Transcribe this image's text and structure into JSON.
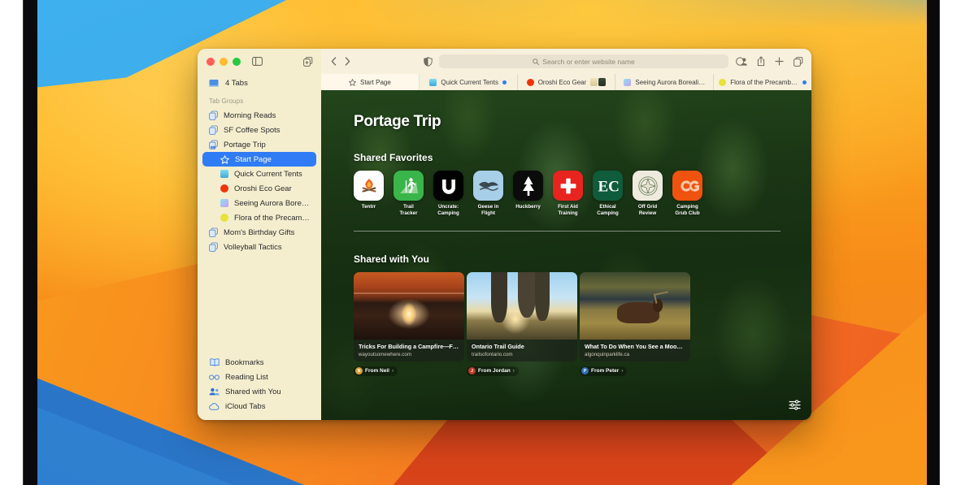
{
  "window": {
    "app": "Safari",
    "traffic_lights": [
      "close",
      "minimize",
      "zoom"
    ],
    "sidebar_toggle": "sidebar-toggle-icon",
    "new_tab_group": "new-tab-group-icon"
  },
  "sidebar": {
    "tabs_count_label": "4 Tabs",
    "section_title": "Tab Groups",
    "groups": [
      {
        "label": "Morning Reads",
        "icon": "tab-group-icon",
        "selected": false,
        "child": false
      },
      {
        "label": "SF Coffee Spots",
        "icon": "tab-group-icon",
        "selected": false,
        "child": false
      },
      {
        "label": "Portage Trip",
        "icon": "tab-group-shared-icon",
        "selected": false,
        "child": false
      },
      {
        "label": "Start Page",
        "icon": "star-icon",
        "selected": true,
        "child": true
      },
      {
        "label": "Quick Current Tents",
        "icon": "favicon",
        "color": "#5ac8e8",
        "selected": false,
        "child": true
      },
      {
        "label": "Oroshi Eco Gear",
        "icon": "favicon",
        "color": "#f0340a",
        "selected": false,
        "child": true,
        "round": true
      },
      {
        "label": "Seeing Aurora Bore…",
        "icon": "favicon",
        "color": "#b08ef0",
        "selected": false,
        "child": true
      },
      {
        "label": "Flora of the Precam…",
        "icon": "favicon",
        "color": "#e8e23a",
        "selected": false,
        "child": true,
        "round": true
      },
      {
        "label": "Mom's Birthday Gifts",
        "icon": "tab-group-icon",
        "selected": false,
        "child": false
      },
      {
        "label": "Volleyball Tactics",
        "icon": "tab-group-icon",
        "selected": false,
        "child": false
      }
    ],
    "bottom_items": [
      {
        "label": "Bookmarks",
        "icon": "book-icon"
      },
      {
        "label": "Reading List",
        "icon": "glasses-icon"
      },
      {
        "label": "Shared with You",
        "icon": "people-icon"
      },
      {
        "label": "iCloud Tabs",
        "icon": "cloud-icon"
      }
    ]
  },
  "toolbar": {
    "back": "chevron-left-icon",
    "forward": "chevron-right-icon",
    "shield": "privacy-report-icon",
    "address_placeholder": "Search or enter website name",
    "search_icon": "magnifier-icon",
    "right_icons": [
      "share-with-person-icon",
      "share-icon",
      "new-tab-icon",
      "tab-overview-icon"
    ]
  },
  "tabs": [
    {
      "label": "Start Page",
      "icon": "star-icon",
      "active": true,
      "badge": "none"
    },
    {
      "label": "Quick Current Tents",
      "icon": "favicon",
      "color": "#5ac8e8",
      "active": false,
      "badge": "blue-dot"
    },
    {
      "label": "Oroshi Eco Gear",
      "icon": "favicon",
      "color": "#f0340a",
      "round": true,
      "active": false,
      "badge": "faces"
    },
    {
      "label": "Seeing Aurora Boreali…",
      "icon": "favicon",
      "color": "#b08ef0",
      "active": false,
      "badge": "none"
    },
    {
      "label": "Flora of the Precambi…",
      "icon": "favicon",
      "color": "#e8e23a",
      "round": true,
      "active": false,
      "badge": "blue-dot"
    }
  ],
  "start_page": {
    "title": "Portage Trip",
    "favorites_heading": "Shared Favorites",
    "favorites": [
      {
        "label": "Tentrr",
        "glyph": "campfire-icon",
        "bg": "#ffffff",
        "fg": "#f0500a"
      },
      {
        "label": "Trail\nTracker",
        "glyph": "hiker-icon",
        "bg": "#3ab54a",
        "fg": "#ffffff"
      },
      {
        "label": "Uncrate:\nCamping",
        "glyph": "u-letter-icon",
        "bg": "#000000",
        "fg": "#ffffff"
      },
      {
        "label": "Geese in\nFlight",
        "glyph": "goose-icon",
        "bg": "#a8cfe8",
        "fg": "#2a3a46"
      },
      {
        "label": "Huckberry",
        "glyph": "tree-icon",
        "bg": "#0b0b0b",
        "fg": "#ffffff"
      },
      {
        "label": "First Aid\nTraining",
        "glyph": "cross-icon",
        "bg": "#e8241f",
        "fg": "#ffffff"
      },
      {
        "label": "Ethical\nCamping",
        "glyph": "ec-letters-icon",
        "bg": "#0e5c3c",
        "fg": "#ffffff"
      },
      {
        "label": "Off Grid\nReview",
        "glyph": "compass-icon",
        "bg": "#efeade",
        "fg": "#5a6a4a"
      },
      {
        "label": "Camping\nGrub Club",
        "glyph": "cg-letters-icon",
        "bg": "#f0520f",
        "fg": "#f5b98a"
      }
    ],
    "shared_heading": "Shared with You",
    "shared_cards": [
      {
        "title": "Tricks For Building a Campfire—F…",
        "url": "wayoutsomewhere.com",
        "from": "From Neil",
        "from_color": "#d8a23a",
        "from_initial": "N",
        "scene": "campfire"
      },
      {
        "title": "Ontario Trail Guide",
        "url": "trailsofontario.com",
        "from": "From Jordan",
        "from_color": "#c0392b",
        "from_initial": "J",
        "scene": "hikers"
      },
      {
        "title": "What To Do When You See a Moo…",
        "url": "algonquinparklife.ca",
        "from": "From Peter",
        "from_color": "#2f6fb0",
        "from_initial": "P",
        "scene": "moose"
      }
    ],
    "settings_button": "start-page-settings-icon"
  }
}
